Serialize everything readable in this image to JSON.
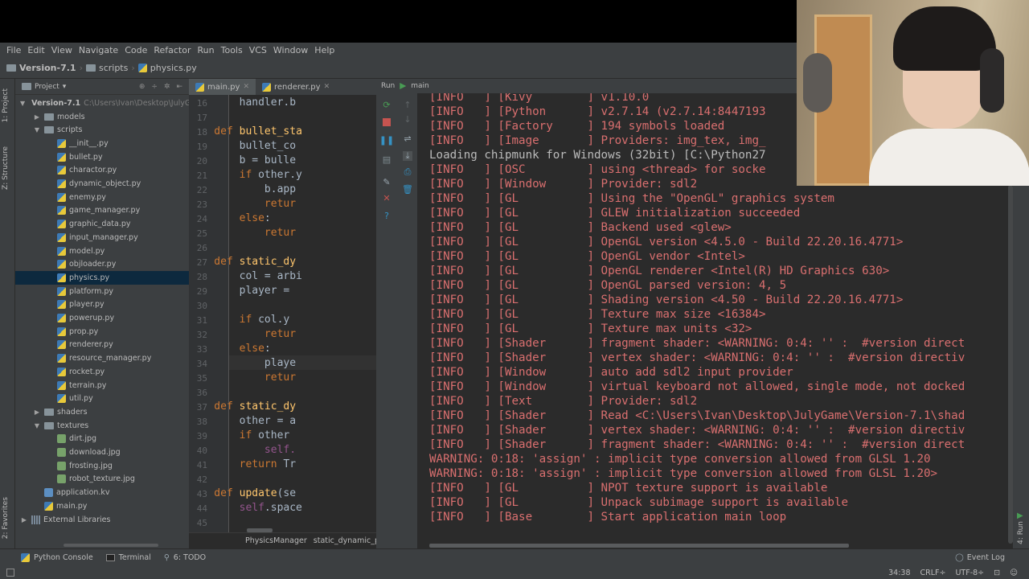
{
  "menu": [
    "File",
    "Edit",
    "View",
    "Navigate",
    "Code",
    "Refactor",
    "Run",
    "Tools",
    "VCS",
    "Window",
    "Help"
  ],
  "nav": {
    "project": "Version-7.1",
    "folder": "scripts",
    "file": "physics.py"
  },
  "left_stripe": {
    "project_tab": "1: Project",
    "structure_tab": "Z: Structure",
    "favorites_tab": "2: Favorites"
  },
  "project_panel": {
    "title": "Project",
    "tree": [
      {
        "label": "Version-7.1",
        "path": "C:\\Users\\Ivan\\Desktop\\JulyG",
        "indent": 0,
        "arrow": "down",
        "icon": "folder",
        "bold": true
      },
      {
        "label": "models",
        "indent": 1,
        "arrow": "right",
        "icon": "folder"
      },
      {
        "label": "scripts",
        "indent": 1,
        "arrow": "down",
        "icon": "folder"
      },
      {
        "label": "__init__.py",
        "indent": 2,
        "icon": "py"
      },
      {
        "label": "bullet.py",
        "indent": 2,
        "icon": "py"
      },
      {
        "label": "charactor.py",
        "indent": 2,
        "icon": "py"
      },
      {
        "label": "dynamic_object.py",
        "indent": 2,
        "icon": "py"
      },
      {
        "label": "enemy.py",
        "indent": 2,
        "icon": "py"
      },
      {
        "label": "game_manager.py",
        "indent": 2,
        "icon": "py"
      },
      {
        "label": "graphic_data.py",
        "indent": 2,
        "icon": "py"
      },
      {
        "label": "input_manager.py",
        "indent": 2,
        "icon": "py"
      },
      {
        "label": "model.py",
        "indent": 2,
        "icon": "py"
      },
      {
        "label": "objloader.py",
        "indent": 2,
        "icon": "py"
      },
      {
        "label": "physics.py",
        "indent": 2,
        "icon": "py",
        "selected": true
      },
      {
        "label": "platform.py",
        "indent": 2,
        "icon": "py"
      },
      {
        "label": "player.py",
        "indent": 2,
        "icon": "py"
      },
      {
        "label": "powerup.py",
        "indent": 2,
        "icon": "py"
      },
      {
        "label": "prop.py",
        "indent": 2,
        "icon": "py"
      },
      {
        "label": "renderer.py",
        "indent": 2,
        "icon": "py"
      },
      {
        "label": "resource_manager.py",
        "indent": 2,
        "icon": "py"
      },
      {
        "label": "rocket.py",
        "indent": 2,
        "icon": "py"
      },
      {
        "label": "terrain.py",
        "indent": 2,
        "icon": "py"
      },
      {
        "label": "util.py",
        "indent": 2,
        "icon": "py"
      },
      {
        "label": "shaders",
        "indent": 1,
        "arrow": "right",
        "icon": "folder"
      },
      {
        "label": "textures",
        "indent": 1,
        "arrow": "down",
        "icon": "folder"
      },
      {
        "label": "dirt.jpg",
        "indent": 2,
        "icon": "img"
      },
      {
        "label": "download.jpg",
        "indent": 2,
        "icon": "img"
      },
      {
        "label": "frosting.jpg",
        "indent": 2,
        "icon": "img"
      },
      {
        "label": "robot_texture.jpg",
        "indent": 2,
        "icon": "img"
      },
      {
        "label": "application.kv",
        "indent": 1,
        "icon": "kv"
      },
      {
        "label": "main.py",
        "indent": 1,
        "icon": "py"
      },
      {
        "label": "External Libraries",
        "indent": 0,
        "arrow": "right",
        "icon": "lib"
      }
    ]
  },
  "editor": {
    "tabs": [
      {
        "label": "main.py",
        "active": true
      },
      {
        "label": "renderer.py",
        "active": false
      }
    ],
    "lines": [
      {
        "n": "16",
        "code": [
          [
            "",
            "        handler.b"
          ]
        ]
      },
      {
        "n": "17",
        "code": []
      },
      {
        "n": "18",
        "code": [
          [
            "kw",
            "    def "
          ],
          [
            "fn",
            "bullet_sta"
          ]
        ]
      },
      {
        "n": "19",
        "code": [
          [
            "",
            "        bullet_co"
          ]
        ]
      },
      {
        "n": "20",
        "code": [
          [
            "",
            "        b = bulle"
          ]
        ]
      },
      {
        "n": "21",
        "code": [
          [
            "kw",
            "        if "
          ],
          [
            "",
            "other.y"
          ]
        ]
      },
      {
        "n": "22",
        "code": [
          [
            "",
            "            b.app"
          ]
        ]
      },
      {
        "n": "23",
        "code": [
          [
            "kw",
            "            retur"
          ]
        ]
      },
      {
        "n": "24",
        "code": [
          [
            "kw",
            "        else"
          ],
          [
            "",
            ":"
          ]
        ]
      },
      {
        "n": "25",
        "code": [
          [
            "kw",
            "            retur"
          ]
        ]
      },
      {
        "n": "26",
        "code": []
      },
      {
        "n": "27",
        "code": [
          [
            "kw",
            "    def "
          ],
          [
            "fn",
            "static_dy"
          ]
        ]
      },
      {
        "n": "28",
        "code": [
          [
            "",
            "        col = arbi"
          ]
        ]
      },
      {
        "n": "29",
        "code": [
          [
            "",
            "        player = "
          ]
        ]
      },
      {
        "n": "30",
        "code": []
      },
      {
        "n": "31",
        "code": [
          [
            "kw",
            "        if "
          ],
          [
            "",
            "col.y "
          ]
        ]
      },
      {
        "n": "32",
        "code": [
          [
            "kw",
            "            retur"
          ]
        ]
      },
      {
        "n": "33",
        "code": [
          [
            "kw",
            "        else"
          ],
          [
            "",
            ":"
          ]
        ]
      },
      {
        "n": "34",
        "code": [
          [
            "",
            "            playe"
          ]
        ]
      },
      {
        "n": "35",
        "code": [
          [
            "kw",
            "            retur"
          ]
        ]
      },
      {
        "n": "36",
        "code": []
      },
      {
        "n": "37",
        "code": [
          [
            "kw",
            "    def "
          ],
          [
            "fn",
            "static_dy"
          ]
        ]
      },
      {
        "n": "38",
        "code": [
          [
            "",
            "        other = a"
          ]
        ]
      },
      {
        "n": "39",
        "code": [
          [
            "kw",
            "        if "
          ],
          [
            "",
            "other "
          ]
        ]
      },
      {
        "n": "40",
        "code": [
          [
            "slf",
            "            self."
          ]
        ]
      },
      {
        "n": "41",
        "code": [
          [
            "kw",
            "        return "
          ],
          [
            "",
            "Tr"
          ]
        ]
      },
      {
        "n": "42",
        "code": []
      },
      {
        "n": "43",
        "code": [
          [
            "kw",
            "    def "
          ],
          [
            "fn",
            "update"
          ],
          [
            "",
            "(se"
          ]
        ]
      },
      {
        "n": "44",
        "code": [
          [
            "slf",
            "        self"
          ],
          [
            "",
            ".space"
          ]
        ]
      },
      {
        "n": "45",
        "code": []
      }
    ],
    "breadcrumb": [
      "PhysicsManager",
      "static_dynamic_p"
    ]
  },
  "run": {
    "label": "Run",
    "config": "main",
    "console": [
      {
        "t": "[INFO   ] [Kivy        ] v1.10.0",
        "c": "info"
      },
      {
        "t": "[INFO   ] [Python      ] v2.7.14 (v2.7.14:8447193",
        "c": "info"
      },
      {
        "t": "[INFO   ] [Factory     ] 194 symbols loaded",
        "c": "info"
      },
      {
        "t": "[INFO   ] [Image       ] Providers: img_tex, img_",
        "c": "info"
      },
      {
        "t": "Loading chipmunk for Windows (32bit) [C:\\Python27",
        "c": "plain"
      },
      {
        "t": "[INFO   ] [OSC         ] using <thread> for socke",
        "c": "info"
      },
      {
        "t": "[INFO   ] [Window      ] Provider: sdl2",
        "c": "info"
      },
      {
        "t": "[INFO   ] [GL          ] Using the \"OpenGL\" graphics system",
        "c": "info"
      },
      {
        "t": "[INFO   ] [GL          ] GLEW initialization succeeded",
        "c": "info"
      },
      {
        "t": "[INFO   ] [GL          ] Backend used <glew>",
        "c": "info"
      },
      {
        "t": "[INFO   ] [GL          ] OpenGL version <4.5.0 - Build 22.20.16.4771>",
        "c": "info"
      },
      {
        "t": "[INFO   ] [GL          ] OpenGL vendor <Intel>",
        "c": "info"
      },
      {
        "t": "[INFO   ] [GL          ] OpenGL renderer <Intel(R) HD Graphics 630>",
        "c": "info"
      },
      {
        "t": "[INFO   ] [GL          ] OpenGL parsed version: 4, 5",
        "c": "info"
      },
      {
        "t": "[INFO   ] [GL          ] Shading version <4.50 - Build 22.20.16.4771>",
        "c": "info"
      },
      {
        "t": "[INFO   ] [GL          ] Texture max size <16384>",
        "c": "info"
      },
      {
        "t": "[INFO   ] [GL          ] Texture max units <32>",
        "c": "info"
      },
      {
        "t": "[INFO   ] [Shader      ] fragment shader: <WARNING: 0:4: '' :  #version direct",
        "c": "info"
      },
      {
        "t": "[INFO   ] [Shader      ] vertex shader: <WARNING: 0:4: '' :  #version directiv",
        "c": "info"
      },
      {
        "t": "[INFO   ] [Window      ] auto add sdl2 input provider",
        "c": "info"
      },
      {
        "t": "[INFO   ] [Window      ] virtual keyboard not allowed, single mode, not docked",
        "c": "info"
      },
      {
        "t": "[INFO   ] [Text        ] Provider: sdl2",
        "c": "info"
      },
      {
        "t": "[INFO   ] [Shader      ] Read <C:\\Users\\Ivan\\Desktop\\JulyGame\\Version-7.1\\shad",
        "c": "info"
      },
      {
        "t": "[INFO   ] [Shader      ] vertex shader: <WARNING: 0:4: '' :  #version directiv",
        "c": "info"
      },
      {
        "t": "[INFO   ] [Shader      ] fragment shader: <WARNING: 0:4: '' :  #version direct",
        "c": "info"
      },
      {
        "t": "WARNING: 0:18: 'assign' : implicit type conversion allowed from GLSL 1.20",
        "c": "info"
      },
      {
        "t": "WARNING: 0:18: 'assign' : implicit type conversion allowed from GLSL 1.20>",
        "c": "info"
      },
      {
        "t": "[INFO   ] [GL          ] NPOT texture support is available",
        "c": "info"
      },
      {
        "t": "[INFO   ] [GL          ] Unpack subimage support is available",
        "c": "info"
      },
      {
        "t": "[INFO   ] [Base        ] Start application main loop",
        "c": "info"
      }
    ]
  },
  "right_stripe": {
    "run_tab": "4: Run"
  },
  "bottom_tools": {
    "python_console": "Python Console",
    "terminal": "Terminal",
    "todo": "6: TODO",
    "event_log": "Event Log"
  },
  "status": {
    "position": "34:38",
    "line_sep": "CRLF÷",
    "encoding": "UTF-8÷"
  },
  "colors": {
    "ide_bg": "#3c3f41",
    "editor_bg": "#2b2b2b",
    "console_text": "#d96f6f",
    "keyword": "#cc7832",
    "function": "#ffc66d",
    "selection": "#0d293e"
  }
}
